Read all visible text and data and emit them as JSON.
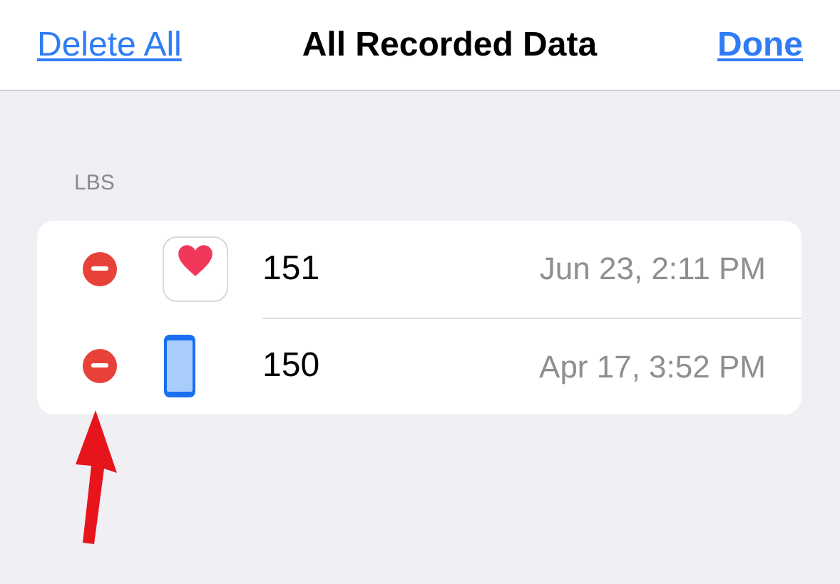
{
  "nav": {
    "left": "Delete All",
    "title": "All Recorded Data",
    "right": "Done"
  },
  "section": {
    "header": "LBS",
    "rows": [
      {
        "kind": "health",
        "value": "151",
        "date": "Jun 23, 2:11 PM"
      },
      {
        "kind": "phone",
        "value": "150",
        "date": "Apr 17, 3:52 PM"
      }
    ]
  }
}
